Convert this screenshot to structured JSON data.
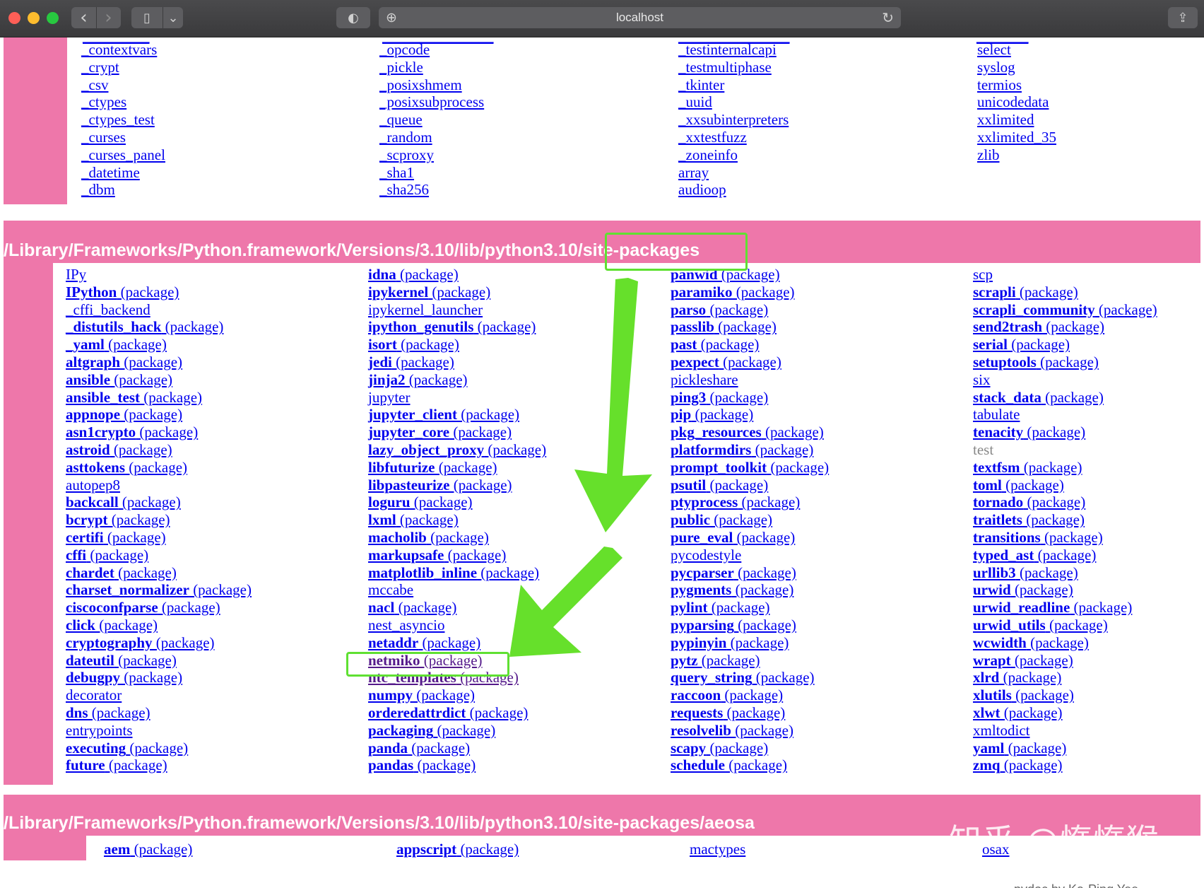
{
  "browser": {
    "url": "localhost",
    "back_glyph": "‹",
    "forward_glyph": "›",
    "sidebar_glyph": "▯",
    "dropdown_glyph": "⌄",
    "shield_glyph": "◐",
    "plus_glyph": "⊕",
    "reload_glyph": "↻",
    "share_glyph": "⇪"
  },
  "top_section": {
    "col1": [
      "_contextvars",
      "_crypt",
      "_csv",
      "_ctypes",
      "_ctypes_test",
      "_curses",
      "_curses_panel",
      "_datetime",
      "_dbm"
    ],
    "col2": [
      "_opcode",
      "_pickle",
      "_posixshmem",
      "_posixsubprocess",
      "_queue",
      "_random",
      "_scproxy",
      "_sha1",
      "_sha256"
    ],
    "col3": [
      "_testinternalcapi",
      "_testmultiphase",
      "_tkinter",
      "_uuid",
      "_xxsubinterpreters",
      "_xxtestfuzz",
      "_zoneinfo",
      "array",
      "audioop"
    ],
    "col4": [
      "select",
      "syslog",
      "termios",
      "unicodedata",
      "xxlimited",
      "xxlimited_35",
      "zlib"
    ]
  },
  "site_packages": {
    "heading": "/Library/Frameworks/Python.framework/Versions/3.10/lib/python3.10/site-packages",
    "pkg_suffix": "(package)",
    "col1": [
      {
        "name": "IPy",
        "pkg": false
      },
      {
        "name": "IPython",
        "pkg": true
      },
      {
        "name": "_cffi_backend",
        "pkg": false
      },
      {
        "name": "_distutils_hack",
        "pkg": true
      },
      {
        "name": "_yaml",
        "pkg": true
      },
      {
        "name": "altgraph",
        "pkg": true
      },
      {
        "name": "ansible",
        "pkg": true
      },
      {
        "name": "ansible_test",
        "pkg": true
      },
      {
        "name": "appnope",
        "pkg": true
      },
      {
        "name": "asn1crypto",
        "pkg": true
      },
      {
        "name": "astroid",
        "pkg": true
      },
      {
        "name": "asttokens",
        "pkg": true
      },
      {
        "name": "autopep8",
        "pkg": false
      },
      {
        "name": "backcall",
        "pkg": true
      },
      {
        "name": "bcrypt",
        "pkg": true
      },
      {
        "name": "certifi",
        "pkg": true
      },
      {
        "name": "cffi",
        "pkg": true
      },
      {
        "name": "chardet",
        "pkg": true
      },
      {
        "name": "charset_normalizer",
        "pkg": true
      },
      {
        "name": "ciscoconfparse",
        "pkg": true
      },
      {
        "name": "click",
        "pkg": true
      },
      {
        "name": "cryptography",
        "pkg": true
      },
      {
        "name": "dateutil",
        "pkg": true
      },
      {
        "name": "debugpy",
        "pkg": true
      },
      {
        "name": "decorator",
        "pkg": false
      },
      {
        "name": "dns",
        "pkg": true
      },
      {
        "name": "entrypoints",
        "pkg": false
      },
      {
        "name": "executing",
        "pkg": true
      },
      {
        "name": "future",
        "pkg": true
      }
    ],
    "col2": [
      {
        "name": "idna",
        "pkg": true
      },
      {
        "name": "ipykernel",
        "pkg": true
      },
      {
        "name": "ipykernel_launcher",
        "pkg": false
      },
      {
        "name": "ipython_genutils",
        "pkg": true
      },
      {
        "name": "isort",
        "pkg": true
      },
      {
        "name": "jedi",
        "pkg": true
      },
      {
        "name": "jinja2",
        "pkg": true
      },
      {
        "name": "jupyter",
        "pkg": false
      },
      {
        "name": "jupyter_client",
        "pkg": true
      },
      {
        "name": "jupyter_core",
        "pkg": true
      },
      {
        "name": "lazy_object_proxy",
        "pkg": true
      },
      {
        "name": "libfuturize",
        "pkg": true
      },
      {
        "name": "libpasteurize",
        "pkg": true
      },
      {
        "name": "loguru",
        "pkg": true
      },
      {
        "name": "lxml",
        "pkg": true
      },
      {
        "name": "macholib",
        "pkg": true
      },
      {
        "name": "markupsafe",
        "pkg": true
      },
      {
        "name": "matplotlib_inline",
        "pkg": true
      },
      {
        "name": "mccabe",
        "pkg": false
      },
      {
        "name": "nacl",
        "pkg": true
      },
      {
        "name": "nest_asyncio",
        "pkg": false
      },
      {
        "name": "netaddr",
        "pkg": true
      },
      {
        "name": "netmiko",
        "pkg": true,
        "visited": true
      },
      {
        "name": "ntc_templates",
        "pkg": true,
        "visited": true
      },
      {
        "name": "numpy",
        "pkg": true
      },
      {
        "name": "orderedattrdict",
        "pkg": true
      },
      {
        "name": "packaging",
        "pkg": true
      },
      {
        "name": "panda",
        "pkg": true
      },
      {
        "name": "pandas",
        "pkg": true
      }
    ],
    "col3": [
      {
        "name": "panwid",
        "pkg": true
      },
      {
        "name": "paramiko",
        "pkg": true
      },
      {
        "name": "parso",
        "pkg": true
      },
      {
        "name": "passlib",
        "pkg": true
      },
      {
        "name": "past",
        "pkg": true
      },
      {
        "name": "pexpect",
        "pkg": true
      },
      {
        "name": "pickleshare",
        "pkg": false
      },
      {
        "name": "ping3",
        "pkg": true
      },
      {
        "name": "pip",
        "pkg": true
      },
      {
        "name": "pkg_resources",
        "pkg": true
      },
      {
        "name": "platformdirs",
        "pkg": true
      },
      {
        "name": "prompt_toolkit",
        "pkg": true
      },
      {
        "name": "psutil",
        "pkg": true
      },
      {
        "name": "ptyprocess",
        "pkg": true
      },
      {
        "name": "public",
        "pkg": true
      },
      {
        "name": "pure_eval",
        "pkg": true
      },
      {
        "name": "pycodestyle",
        "pkg": false
      },
      {
        "name": "pycparser",
        "pkg": true
      },
      {
        "name": "pygments",
        "pkg": true
      },
      {
        "name": "pylint",
        "pkg": true
      },
      {
        "name": "pyparsing",
        "pkg": true
      },
      {
        "name": "pypinyin",
        "pkg": true
      },
      {
        "name": "pytz",
        "pkg": true
      },
      {
        "name": "query_string",
        "pkg": true
      },
      {
        "name": "raccoon",
        "pkg": true
      },
      {
        "name": "requests",
        "pkg": true
      },
      {
        "name": "resolvelib",
        "pkg": true
      },
      {
        "name": "scapy",
        "pkg": true
      },
      {
        "name": "schedule",
        "pkg": true
      }
    ],
    "col4": [
      {
        "name": "scp",
        "pkg": false
      },
      {
        "name": "scrapli",
        "pkg": true
      },
      {
        "name": "scrapli_community",
        "pkg": true
      },
      {
        "name": "send2trash",
        "pkg": true
      },
      {
        "name": "serial",
        "pkg": true
      },
      {
        "name": "setuptools",
        "pkg": true
      },
      {
        "name": "six",
        "pkg": false
      },
      {
        "name": "stack_data",
        "pkg": true
      },
      {
        "name": "tabulate",
        "pkg": false
      },
      {
        "name": "tenacity",
        "pkg": true
      },
      {
        "name": "test",
        "pkg": false,
        "grey": true
      },
      {
        "name": "textfsm",
        "pkg": true
      },
      {
        "name": "toml",
        "pkg": true
      },
      {
        "name": "tornado",
        "pkg": true
      },
      {
        "name": "traitlets",
        "pkg": true
      },
      {
        "name": "transitions",
        "pkg": true
      },
      {
        "name": "typed_ast",
        "pkg": true
      },
      {
        "name": "urllib3",
        "pkg": true
      },
      {
        "name": "urwid",
        "pkg": true
      },
      {
        "name": "urwid_readline",
        "pkg": true
      },
      {
        "name": "urwid_utils",
        "pkg": true
      },
      {
        "name": "wcwidth",
        "pkg": true
      },
      {
        "name": "wrapt",
        "pkg": true
      },
      {
        "name": "xlrd",
        "pkg": true
      },
      {
        "name": "xlutils",
        "pkg": true
      },
      {
        "name": "xlwt",
        "pkg": true
      },
      {
        "name": "xmltodict",
        "pkg": false
      },
      {
        "name": "yaml",
        "pkg": true
      },
      {
        "name": "zmq",
        "pkg": true
      }
    ]
  },
  "aeosa_section": {
    "heading": "/Library/Frameworks/Python.framework/Versions/3.10/lib/python3.10/site-packages/aeosa",
    "items": [
      {
        "name": "aem",
        "pkg": true
      },
      {
        "name": "appscript",
        "pkg": true
      },
      {
        "name": "mactypes",
        "pkg": false
      },
      {
        "name": "osax",
        "pkg": false
      }
    ]
  },
  "watermark": "知乎 @惰惰猴",
  "footer_text": "pydoc by Ka-Ping Yee",
  "colors": {
    "pink": "#ee77aa",
    "link": "#0000ee",
    "visited": "#551a8b",
    "highlight_green": "#5fe032"
  }
}
